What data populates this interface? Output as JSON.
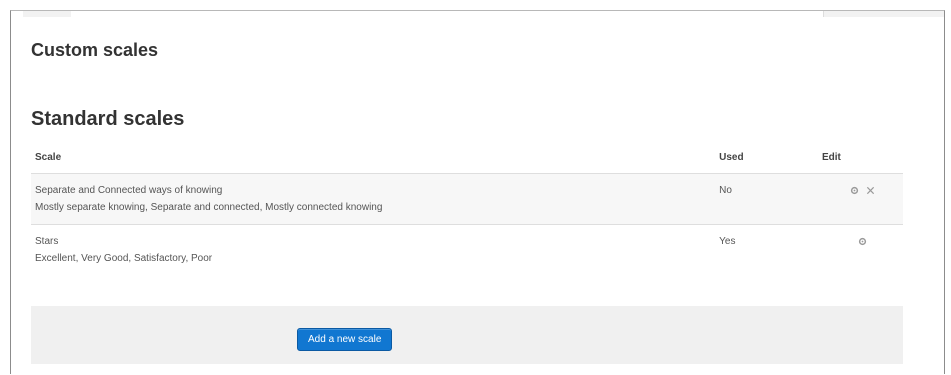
{
  "custom_scales": {
    "heading": "Custom scales"
  },
  "standard_scales": {
    "heading": "Standard scales",
    "columns": {
      "scale": "Scale",
      "used": "Used",
      "edit": "Edit"
    },
    "rows": [
      {
        "name": "Separate and Connected ways of knowing",
        "items": "Mostly separate knowing, Separate and connected, Mostly connected knowing",
        "used": "No",
        "actions": [
          "cog-icon",
          "delete-icon"
        ]
      },
      {
        "name": "Stars",
        "items": "Excellent, Very Good, Satisfactory, Poor",
        "used": "Yes",
        "actions": [
          "cog-icon"
        ]
      }
    ]
  },
  "actions": {
    "add_scale_label": "Add a new scale"
  },
  "colors": {
    "primary_button": "#1177d1",
    "row_stripe": "#f7f7f7",
    "panel_background": "#f0f0f0"
  }
}
